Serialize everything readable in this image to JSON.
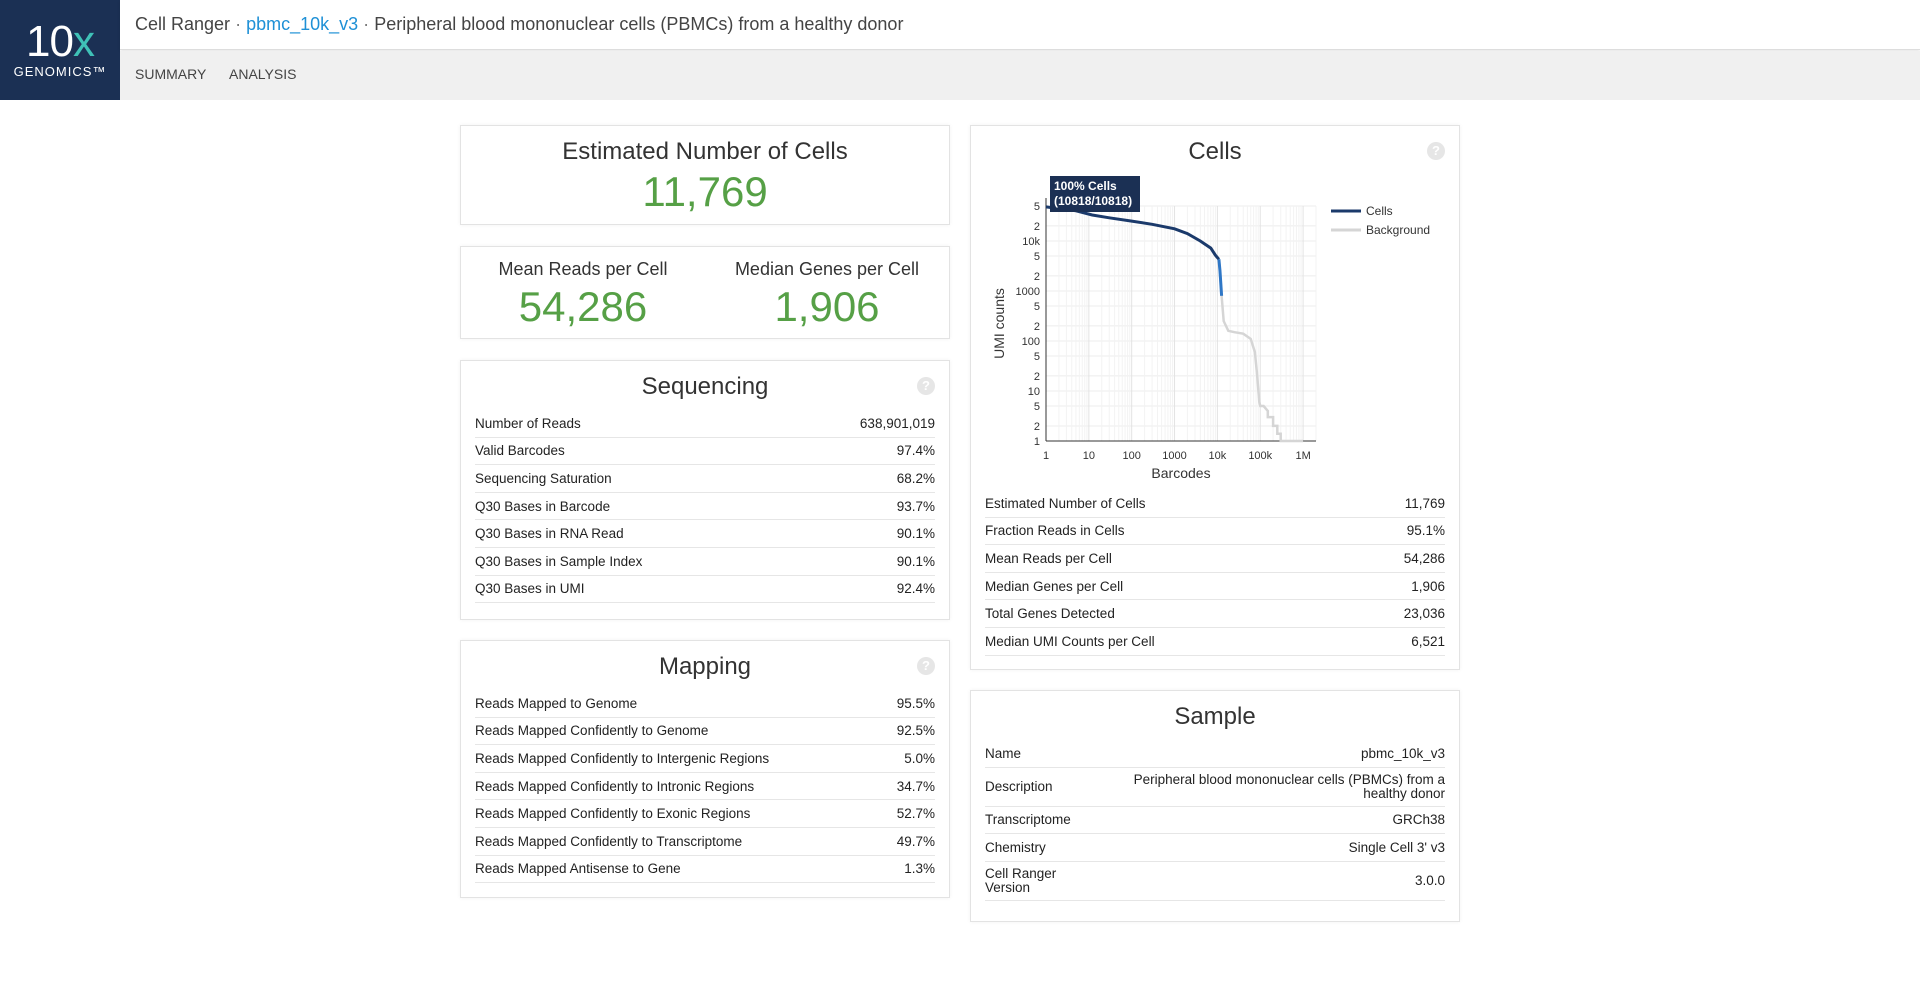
{
  "logo": {
    "mark_a": "10",
    "mark_b": "x",
    "sub": "GENOMICS™"
  },
  "header": {
    "app": "Cell Ranger",
    "sep": "·",
    "sample_link": "pbmc_10k_v3",
    "description": "Peripheral blood mononuclear cells (PBMCs) from a healthy donor"
  },
  "nav": {
    "tabs": [
      {
        "label": "SUMMARY"
      },
      {
        "label": "ANALYSIS"
      }
    ]
  },
  "hero": {
    "label": "Estimated Number of Cells",
    "value": "11,769"
  },
  "pair": {
    "left": {
      "label": "Mean Reads per Cell",
      "value": "54,286"
    },
    "right": {
      "label": "Median Genes per Cell",
      "value": "1,906"
    }
  },
  "sequencing": {
    "title": "Sequencing",
    "help": "?",
    "rows": [
      {
        "label": "Number of Reads",
        "value": "638,901,019"
      },
      {
        "label": "Valid Barcodes",
        "value": "97.4%"
      },
      {
        "label": "Sequencing Saturation",
        "value": "68.2%"
      },
      {
        "label": "Q30 Bases in Barcode",
        "value": "93.7%"
      },
      {
        "label": "Q30 Bases in RNA Read",
        "value": "90.1%"
      },
      {
        "label": "Q30 Bases in Sample Index",
        "value": "90.1%"
      },
      {
        "label": "Q30 Bases in UMI",
        "value": "92.4%"
      }
    ]
  },
  "mapping": {
    "title": "Mapping",
    "help": "?",
    "rows": [
      {
        "label": "Reads Mapped to Genome",
        "value": "95.5%"
      },
      {
        "label": "Reads Mapped Confidently to Genome",
        "value": "92.5%"
      },
      {
        "label": "Reads Mapped Confidently to Intergenic Regions",
        "value": "5.0%"
      },
      {
        "label": "Reads Mapped Confidently to Intronic Regions",
        "value": "34.7%"
      },
      {
        "label": "Reads Mapped Confidently to Exonic Regions",
        "value": "52.7%"
      },
      {
        "label": "Reads Mapped Confidently to Transcriptome",
        "value": "49.7%"
      },
      {
        "label": "Reads Mapped Antisense to Gene",
        "value": "1.3%"
      }
    ]
  },
  "cells": {
    "title": "Cells",
    "help": "?",
    "rows": [
      {
        "label": "Estimated Number of Cells",
        "value": "11,769"
      },
      {
        "label": "Fraction Reads in Cells",
        "value": "95.1%"
      },
      {
        "label": "Mean Reads per Cell",
        "value": "54,286"
      },
      {
        "label": "Median Genes per Cell",
        "value": "1,906"
      },
      {
        "label": "Total Genes Detected",
        "value": "23,036"
      },
      {
        "label": "Median UMI Counts per Cell",
        "value": "6,521"
      }
    ]
  },
  "sample": {
    "title": "Sample",
    "rows": [
      {
        "label": "Name",
        "value": "pbmc_10k_v3"
      },
      {
        "label": "Description",
        "value": "Peripheral blood mononuclear cells (PBMCs) from a healthy donor"
      },
      {
        "label": "Transcriptome",
        "value": "GRCh38"
      },
      {
        "label": "Chemistry",
        "value": "Single Cell 3' v3"
      },
      {
        "label": "Cell Ranger Version",
        "value": "3.0.0"
      }
    ]
  },
  "chart_data": {
    "type": "line",
    "xlabel": "Barcodes",
    "ylabel": "UMI counts",
    "x_scale": "log",
    "y_scale": "log",
    "xlim": [
      1,
      2000000
    ],
    "ylim": [
      1,
      50000
    ],
    "grid": true,
    "legend_position": "top-right",
    "x_ticks": [
      "1",
      "10",
      "100",
      "1000",
      "10k",
      "100k",
      "1M"
    ],
    "y_ticks": [
      "1",
      "2",
      "5",
      "10",
      "2",
      "5",
      "100",
      "2",
      "5",
      "1000",
      "2",
      "5",
      "10k",
      "2",
      "5"
    ],
    "tooltip": {
      "line1": "100% Cells",
      "line2": "(10818/10818)"
    },
    "colors": {
      "cells": "#1b3a6b",
      "background": "#d5d5d5",
      "transition": "#2f77c6"
    },
    "series": [
      {
        "name": "Cells",
        "x": [
          1,
          5,
          12,
          30,
          100,
          300,
          1000,
          2000,
          4000,
          7000,
          9000,
          10818
        ],
        "y": [
          48000,
          40000,
          33000,
          29000,
          25000,
          21500,
          17500,
          14000,
          10000,
          7200,
          5200,
          4300
        ]
      },
      {
        "name": "Background",
        "x": [
          10818,
          11500,
          12500,
          14000,
          18000,
          25000,
          40000,
          60000,
          75000,
          85000,
          95000,
          100000,
          120000,
          150000,
          150000,
          200000,
          200000,
          250000,
          250000,
          300000,
          300000,
          600000,
          1000000
        ],
        "y": [
          4300,
          2500,
          800,
          250,
          160,
          150,
          140,
          110,
          60,
          20,
          6,
          5,
          5,
          4,
          3,
          3,
          2,
          2,
          1.4,
          1.4,
          1,
          1,
          1
        ]
      }
    ]
  }
}
